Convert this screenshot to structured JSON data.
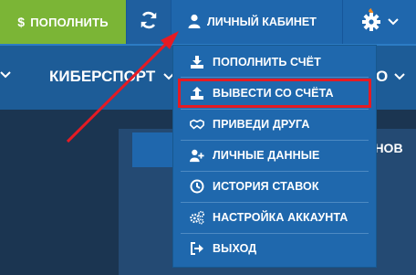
{
  "topbar": {
    "refill_label": "ПОПОЛНИТЬ",
    "refill_currency": "$",
    "cabinet_label": "ЛИЧНЫЙ КАБИНЕТ"
  },
  "nav": {
    "esports_label": "КИБЕРСПОРТ",
    "partial_right": "О"
  },
  "content": {
    "partial_text": "ЮНОВ"
  },
  "dropdown": {
    "items": [
      {
        "label": "ПОПОЛНИТЬ СЧЁТ",
        "icon": "download-icon"
      },
      {
        "label": "ВЫВЕСТИ СО СЧЁТА",
        "icon": "upload-icon",
        "highlighted": true
      },
      {
        "label": "ПРИВЕДИ ДРУГА",
        "icon": "handshake-icon"
      },
      {
        "label": "ЛИЧНЫЕ ДАННЫЕ",
        "icon": "user-plus-icon"
      },
      {
        "label": "ИСТОРИЯ СТАВОК",
        "icon": "clock-icon"
      },
      {
        "label": "НАСТРОЙКА АККАУНТА",
        "icon": "cogs-icon"
      },
      {
        "label": "ВЫХОД",
        "icon": "sign-out-icon"
      }
    ]
  },
  "colors": {
    "refill_green": "#7bb536",
    "header_blue": "#1f67ad",
    "highlight_red": "#e51b23",
    "arrow_red": "#e51b23",
    "gear_orange": "#f08a24"
  }
}
